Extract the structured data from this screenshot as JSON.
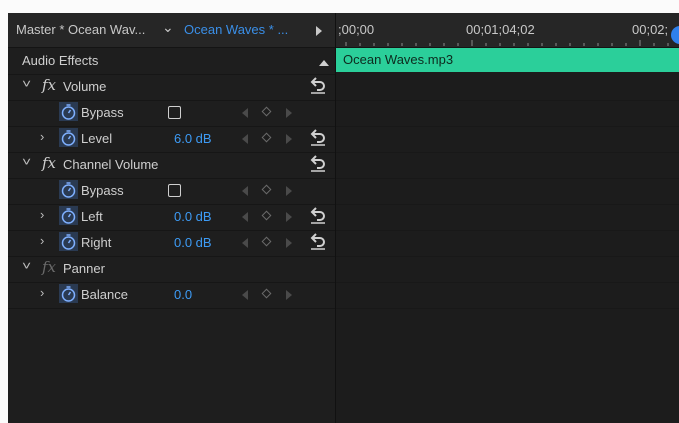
{
  "panel": {
    "master_tab": "Master * Ocean Wav...",
    "clip_tab": "Ocean Waves * ..."
  },
  "section": {
    "title": "Audio Effects"
  },
  "effects": [
    {
      "name": "Volume",
      "params": [
        {
          "label": "Bypass",
          "type": "checkbox",
          "checked": false
        },
        {
          "label": "Level",
          "value": "6.0 dB"
        }
      ]
    },
    {
      "name": "Channel Volume",
      "params": [
        {
          "label": "Bypass",
          "type": "checkbox",
          "checked": false
        },
        {
          "label": "Left",
          "value": "0.0 dB"
        },
        {
          "label": "Right",
          "value": "0.0 dB"
        }
      ]
    },
    {
      "name": "Panner",
      "params": [
        {
          "label": "Balance",
          "value": "0.0"
        }
      ]
    }
  ],
  "timeline": {
    "timecodes": [
      ";00;00",
      "00;01;04;02",
      "00;02;"
    ],
    "clip_name": "Ocean Waves.mp3"
  },
  "colors": {
    "accent": "#3d9bf5",
    "clip": "#2bcf9a",
    "panel": "#1e1e1e"
  },
  "icons": [
    "fx-icon",
    "stopwatch-icon",
    "reset-icon",
    "keyframe-nav-icon"
  ]
}
